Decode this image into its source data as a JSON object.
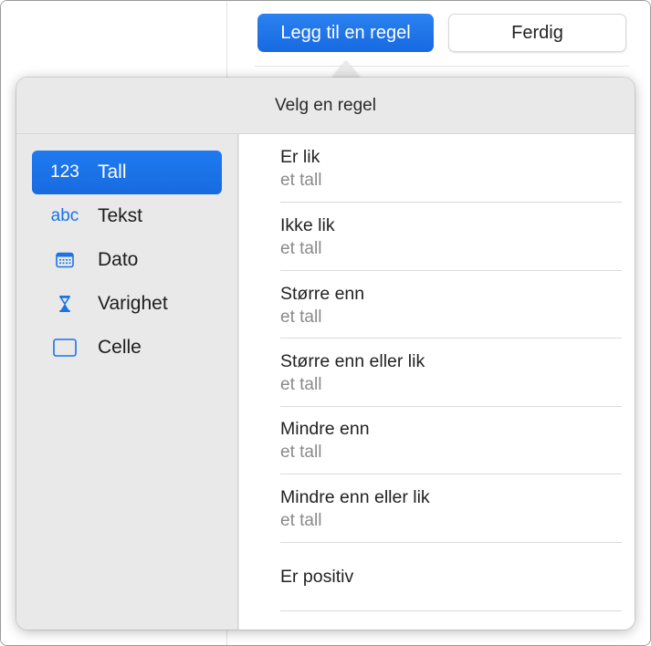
{
  "toolbar": {
    "add_rule_label": "Legg til en regel",
    "done_label": "Ferdig"
  },
  "popover": {
    "title": "Velg en regel"
  },
  "sidebar": {
    "items": [
      {
        "icon": "123",
        "icon_name": "number-icon",
        "label": "Tall",
        "selected": true
      },
      {
        "icon": "abc",
        "icon_name": "text-icon",
        "label": "Tekst",
        "selected": false
      },
      {
        "icon": "",
        "icon_name": "calendar-icon",
        "label": "Dato",
        "selected": false
      },
      {
        "icon": "",
        "icon_name": "hourglass-icon",
        "label": "Varighet",
        "selected": false
      },
      {
        "icon": "",
        "icon_name": "cell-icon",
        "label": "Celle",
        "selected": false
      }
    ]
  },
  "rules": [
    {
      "title": "Er lik",
      "subtitle": "et tall"
    },
    {
      "title": "Ikke lik",
      "subtitle": "et tall"
    },
    {
      "title": "Større enn",
      "subtitle": "et tall"
    },
    {
      "title": "Større enn eller lik",
      "subtitle": "et tall"
    },
    {
      "title": "Mindre enn",
      "subtitle": "et tall"
    },
    {
      "title": "Mindre enn eller lik",
      "subtitle": "et tall"
    },
    {
      "title": "Er positiv",
      "subtitle": ""
    }
  ],
  "colors": {
    "accent": "#1a73e8",
    "popover_bg": "#e9e9e9",
    "secondary_text": "#8a8a8a"
  }
}
